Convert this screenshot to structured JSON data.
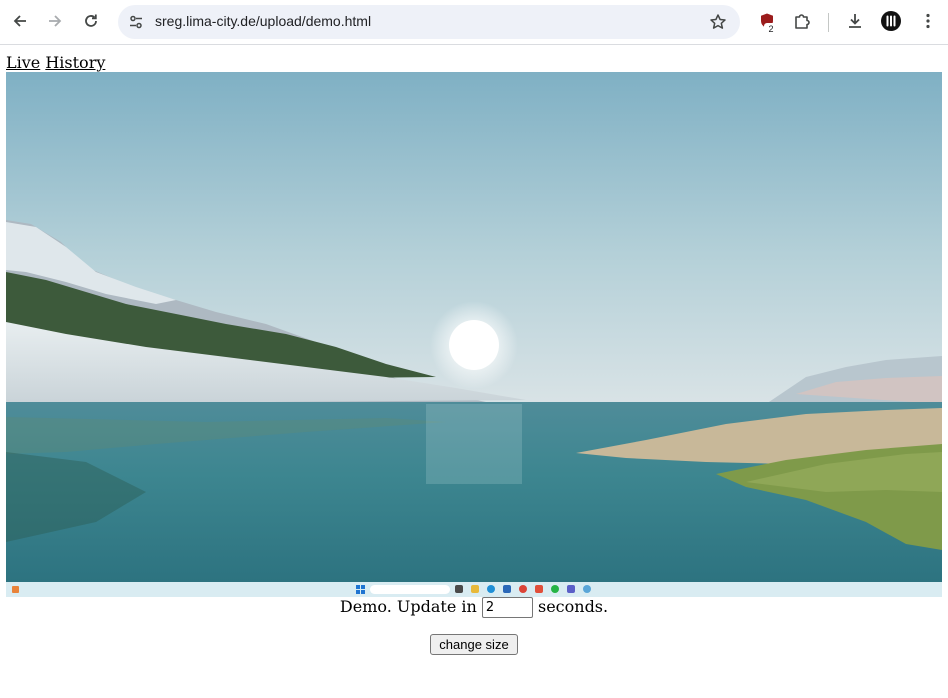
{
  "browser": {
    "url": "sreg.lima-city.de/upload/demo.html",
    "extension_badge": "2",
    "icons": {
      "back": "arrow-left-icon",
      "forward": "arrow-right-icon",
      "reload": "reload-icon",
      "site_info": "tune-icon",
      "bookmark": "star-icon",
      "extension_shield": "shield-icon",
      "extensions": "puzzle-icon",
      "downloads": "download-icon",
      "profile": "profile-icon",
      "menu": "kebab-menu-icon"
    }
  },
  "page": {
    "links": [
      {
        "label": "Live"
      },
      {
        "label": "History"
      }
    ],
    "screenshot": {
      "subject": "desktop screenshot of a lake landscape wallpaper with Windows taskbar"
    },
    "status": {
      "prefix": "Demo. Update in",
      "interval_value": "2",
      "suffix": "seconds."
    },
    "change_size_label": "change size"
  },
  "colors": {
    "chrome_bg": "#ffffff",
    "omnibox_bg": "#eef1f8",
    "extension_shield": "#9b1c1c",
    "taskbar": "#d9ecf2"
  }
}
